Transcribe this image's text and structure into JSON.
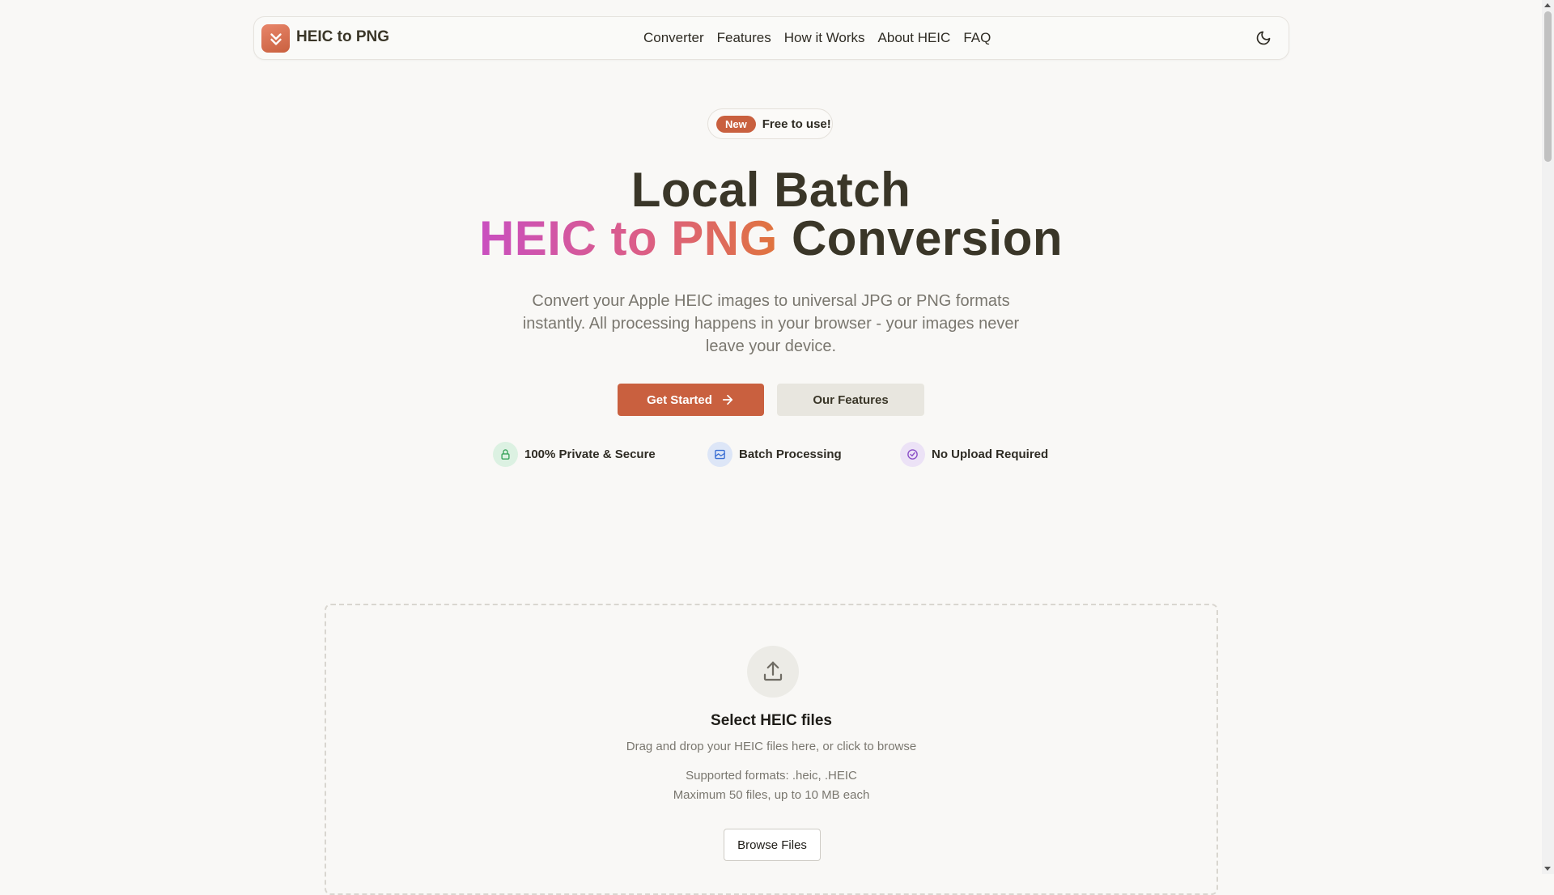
{
  "nav": {
    "brand": "HEIC to PNG",
    "links": [
      "Converter",
      "Features",
      "How it Works",
      "About HEIC",
      "FAQ"
    ]
  },
  "promo": {
    "badge": "New",
    "text": "Free to use!"
  },
  "hero": {
    "line1": "Local Batch",
    "line2_highlight": "HEIC to PNG",
    "line2_rest": "Conversion",
    "subtitle": "Convert your Apple HEIC images to universal JPG or PNG formats instantly. All processing happens in your browser - your images never leave your device."
  },
  "actions": {
    "primary": "Get Started",
    "secondary": "Our Features"
  },
  "features": [
    "100% Private & Secure",
    "Batch Processing",
    "No Upload Required"
  ],
  "dropzone": {
    "title": "Select HEIC files",
    "description": "Drag and drop your HEIC files here, or click to browse",
    "formats": "Supported formats: .heic, .HEIC",
    "limit": "Maximum 50 files, up to 10 MB each",
    "browse": "Browse Files"
  },
  "colors": {
    "accent": "#c9603f",
    "text": "#3a3628",
    "muted": "#7a776f"
  },
  "icons": [
    "chevrons-down-icon",
    "moon-icon",
    "arrow-right-icon",
    "lock-icon",
    "image-icon",
    "check-circle-icon",
    "upload-icon"
  ]
}
